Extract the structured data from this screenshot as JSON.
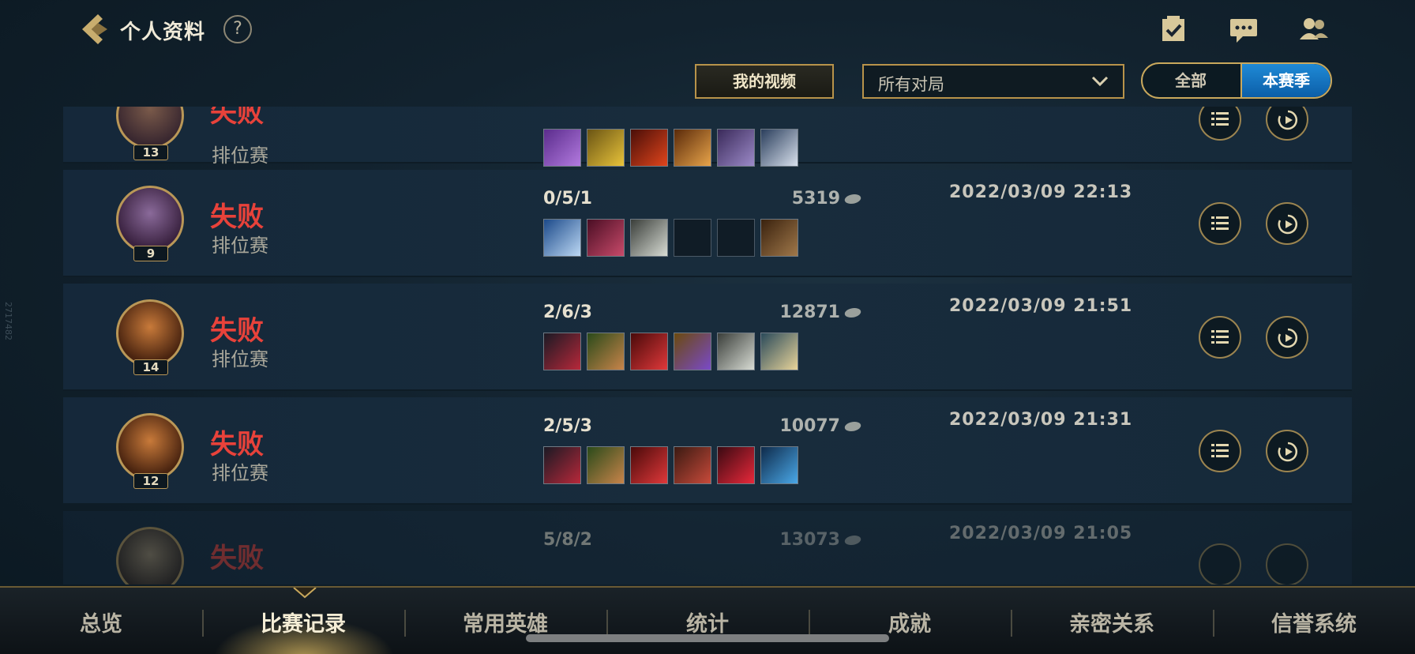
{
  "header": {
    "title": "个人资料",
    "help_label": "?",
    "top_icons": [
      "checklist-icon",
      "chat-icon",
      "friends-icon"
    ]
  },
  "filters": {
    "my_video_label": "我的视频",
    "match_filter_value": "所有对局",
    "toggle_all_label": "全部",
    "toggle_season_label": "本赛季",
    "toggle_selected": "本赛季"
  },
  "side_id": "2717482",
  "matches": [
    {
      "level": "13",
      "result": "失败",
      "mode": "排位赛",
      "kda": "",
      "gold": "",
      "date": "",
      "items": [
        "purple",
        "gold",
        "red",
        "orange",
        "purple",
        "blue"
      ]
    },
    {
      "level": "9",
      "result": "失败",
      "mode": "排位赛",
      "kda": "0/5/1",
      "gold": "5319",
      "date": "2022/03/09 22:13",
      "items": [
        "blue",
        "crimson",
        "gray",
        "empty",
        "empty",
        "brown"
      ]
    },
    {
      "level": "14",
      "result": "失败",
      "mode": "排位赛",
      "kda": "2/6/3",
      "gold": "12871",
      "date": "2022/03/09 21:51",
      "items": [
        "dark",
        "green",
        "red",
        "violet",
        "gray",
        "teal"
      ]
    },
    {
      "level": "12",
      "result": "失败",
      "mode": "排位赛",
      "kda": "2/5/3",
      "gold": "10077",
      "date": "2022/03/09 21:31",
      "items": [
        "dark",
        "green",
        "red",
        "brownred",
        "crimson",
        "blue"
      ]
    },
    {
      "level": "",
      "result": "失败",
      "mode": "",
      "kda": "5/8/2",
      "gold": "13073",
      "date": "2022/03/09 21:05",
      "items": []
    }
  ],
  "tabs": [
    {
      "label": "总览"
    },
    {
      "label": "比赛记录"
    },
    {
      "label": "常用英雄"
    },
    {
      "label": "统计"
    },
    {
      "label": "成就"
    },
    {
      "label": "亲密关系"
    },
    {
      "label": "信誉系统"
    }
  ],
  "active_tab": "比赛记录",
  "colors": {
    "accent_gold": "#b8934a",
    "loss_red": "#e8423a",
    "season_blue": "#1f8ad6"
  }
}
